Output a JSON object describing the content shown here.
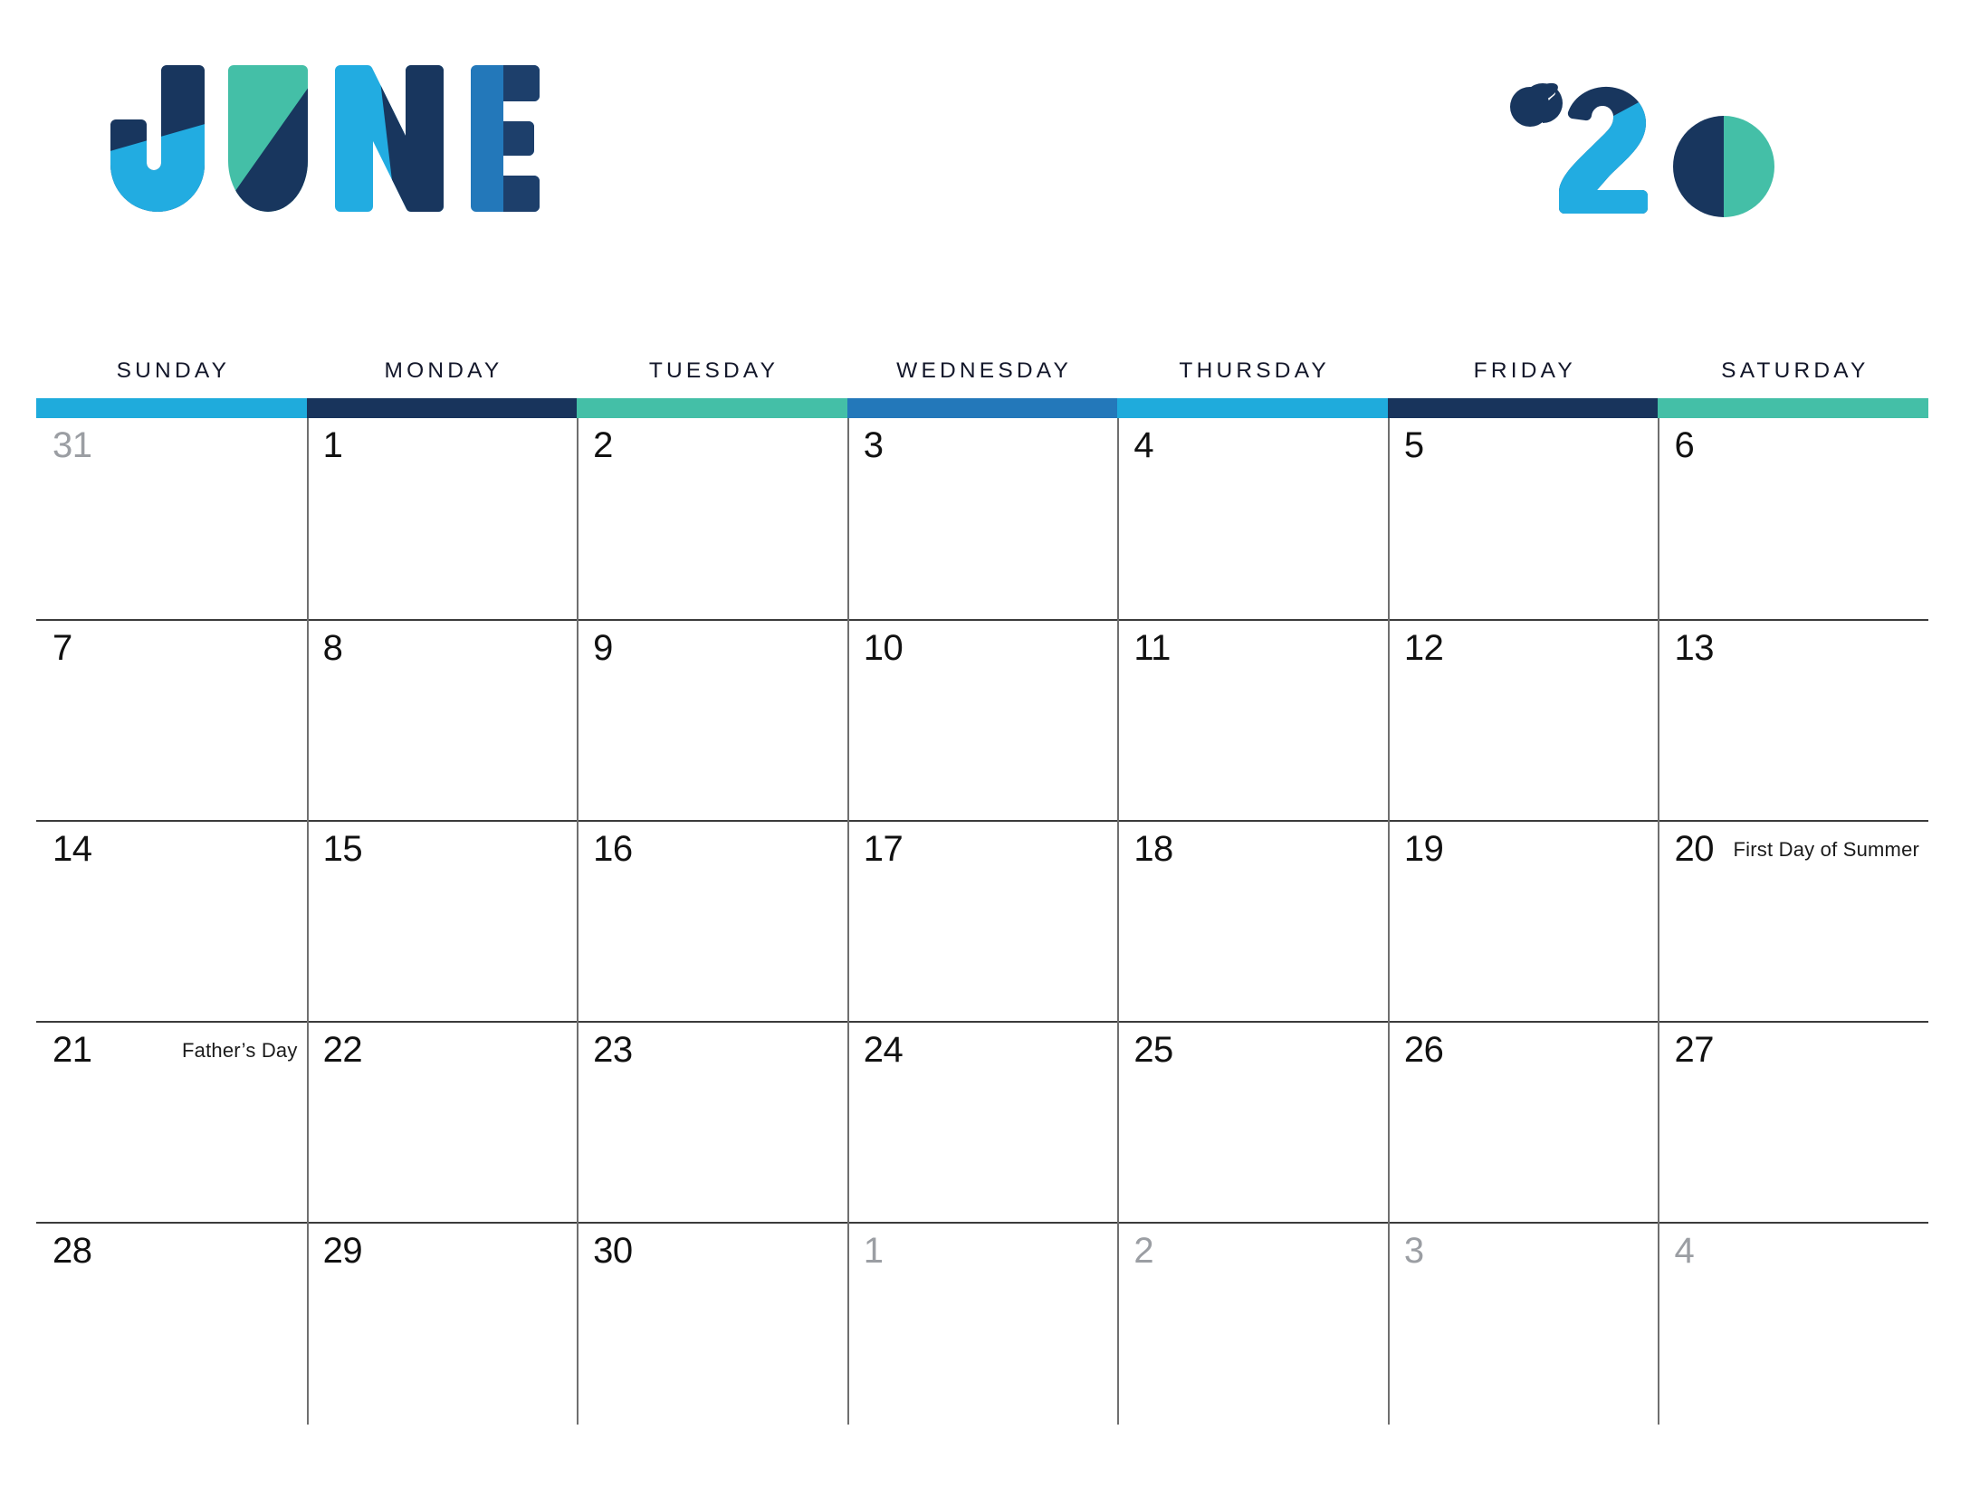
{
  "masthead": {
    "month": "JUNE",
    "year": "'20",
    "month_letters": [
      {
        "char": "J",
        "colors": [
          "#18365e",
          "#22ace1"
        ]
      },
      {
        "char": "U",
        "colors": [
          "#44bfa7",
          "#18365e"
        ]
      },
      {
        "char": "N",
        "colors": [
          "#22ace1",
          "#18365e"
        ]
      },
      {
        "char": "E",
        "colors": [
          "#2378ba",
          "#18365e"
        ]
      }
    ],
    "year_glyphs": [
      {
        "char": "'",
        "colors": [
          "#18365e"
        ]
      },
      {
        "char": "2",
        "colors": [
          "#18365e",
          "#22ace1"
        ]
      },
      {
        "char": "0",
        "colors": [
          "#18365e",
          "#44bfa7"
        ]
      }
    ]
  },
  "palette": {
    "navy": "#18365e",
    "cyan": "#1fabdc",
    "teal": "#44bfa7",
    "blue": "#2378ba",
    "text": "#111111",
    "muted": "#9b9ea3",
    "rule": "#3b3b3b"
  },
  "weekdays": [
    {
      "label": "SUNDAY",
      "bar_color": "#1fabdc"
    },
    {
      "label": "MONDAY",
      "bar_color": "#18345c"
    },
    {
      "label": "TUESDAY",
      "bar_color": "#44bfa7"
    },
    {
      "label": "WEDNESDAY",
      "bar_color": "#2378ba"
    },
    {
      "label": "THURSDAY",
      "bar_color": "#1fabdc"
    },
    {
      "label": "FRIDAY",
      "bar_color": "#18345c"
    },
    {
      "label": "SATURDAY",
      "bar_color": "#44bfa7"
    }
  ],
  "weeks": [
    [
      {
        "day": "31",
        "muted": true,
        "event": ""
      },
      {
        "day": "1",
        "muted": false,
        "event": ""
      },
      {
        "day": "2",
        "muted": false,
        "event": ""
      },
      {
        "day": "3",
        "muted": false,
        "event": ""
      },
      {
        "day": "4",
        "muted": false,
        "event": ""
      },
      {
        "day": "5",
        "muted": false,
        "event": ""
      },
      {
        "day": "6",
        "muted": false,
        "event": ""
      }
    ],
    [
      {
        "day": "7",
        "muted": false,
        "event": ""
      },
      {
        "day": "8",
        "muted": false,
        "event": ""
      },
      {
        "day": "9",
        "muted": false,
        "event": ""
      },
      {
        "day": "10",
        "muted": false,
        "event": ""
      },
      {
        "day": "11",
        "muted": false,
        "event": ""
      },
      {
        "day": "12",
        "muted": false,
        "event": ""
      },
      {
        "day": "13",
        "muted": false,
        "event": ""
      }
    ],
    [
      {
        "day": "14",
        "muted": false,
        "event": ""
      },
      {
        "day": "15",
        "muted": false,
        "event": ""
      },
      {
        "day": "16",
        "muted": false,
        "event": ""
      },
      {
        "day": "17",
        "muted": false,
        "event": ""
      },
      {
        "day": "18",
        "muted": false,
        "event": ""
      },
      {
        "day": "19",
        "muted": false,
        "event": ""
      },
      {
        "day": "20",
        "muted": false,
        "event": "First Day of Summer"
      }
    ],
    [
      {
        "day": "21",
        "muted": false,
        "event": "Father’s Day"
      },
      {
        "day": "22",
        "muted": false,
        "event": ""
      },
      {
        "day": "23",
        "muted": false,
        "event": ""
      },
      {
        "day": "24",
        "muted": false,
        "event": ""
      },
      {
        "day": "25",
        "muted": false,
        "event": ""
      },
      {
        "day": "26",
        "muted": false,
        "event": ""
      },
      {
        "day": "27",
        "muted": false,
        "event": ""
      }
    ],
    [
      {
        "day": "28",
        "muted": false,
        "event": ""
      },
      {
        "day": "29",
        "muted": false,
        "event": ""
      },
      {
        "day": "30",
        "muted": false,
        "event": ""
      },
      {
        "day": "1",
        "muted": true,
        "event": ""
      },
      {
        "day": "2",
        "muted": true,
        "event": ""
      },
      {
        "day": "3",
        "muted": true,
        "event": ""
      },
      {
        "day": "4",
        "muted": true,
        "event": ""
      }
    ]
  ]
}
